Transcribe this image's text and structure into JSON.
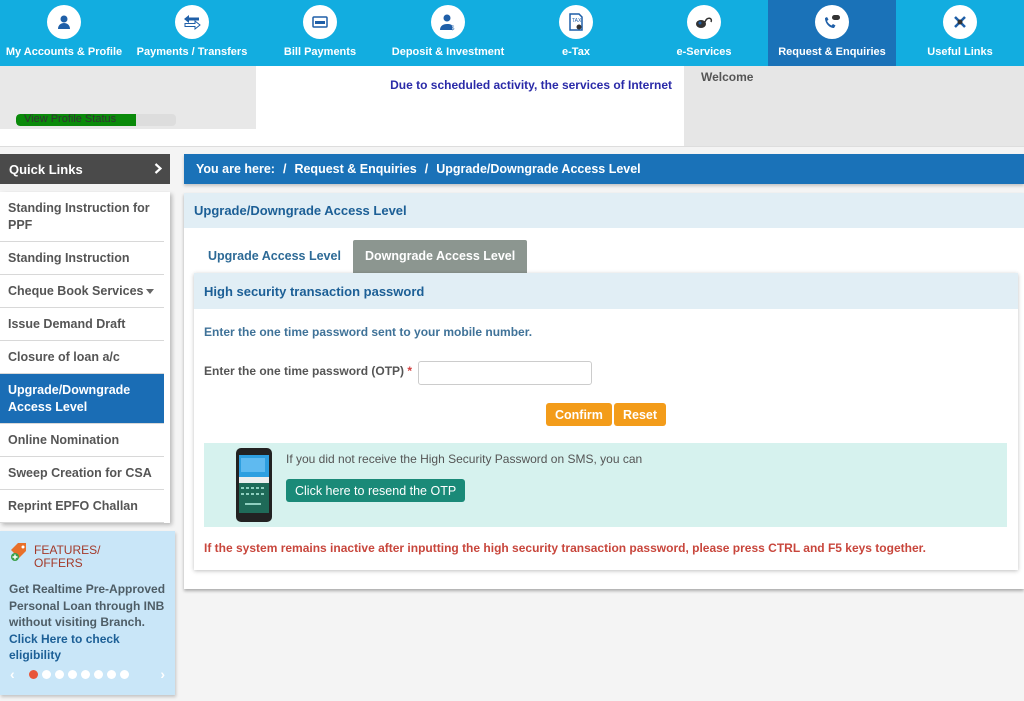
{
  "nav": {
    "items": [
      {
        "label": "My Accounts & Profile",
        "icon": "user-icon"
      },
      {
        "label": "Payments / Transfers",
        "icon": "transfer-icon"
      },
      {
        "label": "Bill Payments",
        "icon": "bill-icon"
      },
      {
        "label": "Deposit & Investment",
        "icon": "deposit-icon"
      },
      {
        "label": "e-Tax",
        "icon": "tax-icon"
      },
      {
        "label": "e-Services",
        "icon": "eservices-icon"
      },
      {
        "label": "Request & Enquiries",
        "icon": "phone-chat-icon",
        "active": true
      },
      {
        "label": "Useful Links",
        "icon": "links-icon"
      }
    ]
  },
  "header": {
    "profile_status_label": "View Profile Status",
    "profile_status_progress": 0.75,
    "notice": "Due to scheduled activity, the services of Internet",
    "welcome": "Welcome"
  },
  "sidebar": {
    "quick_links_label": "Quick Links",
    "items": [
      {
        "label": "Standing Instruction for PPF"
      },
      {
        "label": "Standing Instruction"
      },
      {
        "label": "Cheque Book Services",
        "has_dropdown": true
      },
      {
        "label": "Issue Demand Draft"
      },
      {
        "label": "Closure of loan a/c"
      },
      {
        "label": "Upgrade/Downgrade Access Level",
        "active": true
      },
      {
        "label": "Online Nomination"
      },
      {
        "label": "Sweep Creation for CSA"
      },
      {
        "label": "Reprint EPFO Challan"
      }
    ],
    "offers": {
      "title": "FEATURES/ OFFERS",
      "text": "Get Realtime Pre-Approved Personal Loan through INB without visiting Branch.",
      "link": "Click Here to check eligibility",
      "slide_count": 8,
      "active_slide": 1,
      "prev": "‹",
      "next": "›"
    }
  },
  "breadcrumb": {
    "prefix": "You are here:",
    "sep": "/",
    "items": [
      "Request & Enquiries",
      "Upgrade/Downgrade Access Level"
    ]
  },
  "main": {
    "title": "Upgrade/Downgrade Access Level",
    "tabs": [
      {
        "label": "Upgrade Access Level"
      },
      {
        "label": "Downgrade Access Level",
        "active": true
      }
    ],
    "otp": {
      "heading": "High security transaction password",
      "info": "Enter the one time password sent to your mobile number.",
      "field_label": "Enter the one time password (OTP)",
      "required_mark": "*",
      "value": "",
      "confirm_label": "Confirm",
      "reset_label": "Reset",
      "resend_text": "If you did not receive the High Security Password on SMS, you can",
      "resend_button": "Click here to resend the OTP",
      "warning": "If the system remains inactive after inputting the high security transaction password, please press CTRL and F5 keys together."
    }
  },
  "colors": {
    "nav_bg": "#12ade0",
    "nav_active": "#1a72b8",
    "breadcrumb_bg": "#1a72b8",
    "button_orange": "#f39c1a",
    "button_teal": "#1a8a78",
    "warning_text": "#c8463c"
  }
}
